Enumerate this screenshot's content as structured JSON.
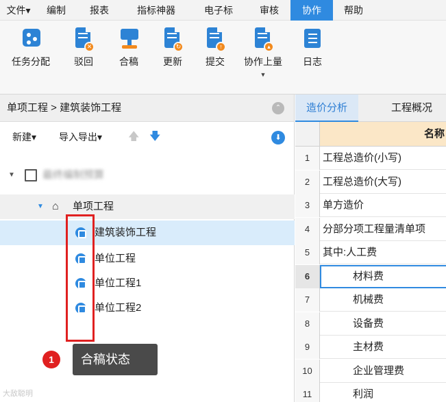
{
  "menu": {
    "items": [
      "文件▾",
      "编制",
      "报表",
      "指标神器",
      "电子标",
      "审核",
      "协作",
      "帮助"
    ],
    "active": "协作"
  },
  "ribbon": {
    "buttons": [
      {
        "label": "任务分配",
        "icon": "task-assign-icon"
      },
      {
        "label": "驳回",
        "icon": "reject-icon"
      },
      {
        "label": "合稿",
        "icon": "merge-icon"
      },
      {
        "label": "更新",
        "icon": "update-icon"
      },
      {
        "label": "提交",
        "icon": "submit-icon"
      },
      {
        "label": "协作上量",
        "icon": "collab-upload-icon"
      },
      {
        "label": "日志",
        "icon": "log-icon"
      }
    ],
    "dropdown_glyph": "▼"
  },
  "left": {
    "breadcrumb": "单项工程 > 建筑装饰工程",
    "toolbar": {
      "new_label": "新建▾",
      "import_export_label": "导入导出▾"
    },
    "tree": {
      "root_label": "最终编制预算",
      "group_label": "单项工程",
      "items": [
        "建筑装饰工程",
        "单位工程",
        "单位工程1",
        "单位工程2"
      ],
      "selected": "建筑装饰工程"
    },
    "callout": {
      "number": "1",
      "text": "合稿状态"
    },
    "watermark": "大敌聪明"
  },
  "right": {
    "tabs": [
      "造价分析",
      "工程概况"
    ],
    "active_tab": "造价分析",
    "table": {
      "header_name": "名称",
      "rows": [
        {
          "n": "1",
          "name": "工程总造价(小写)",
          "indent": false
        },
        {
          "n": "2",
          "name": "工程总造价(大写)",
          "indent": false
        },
        {
          "n": "3",
          "name": "单方造价",
          "indent": false
        },
        {
          "n": "4",
          "name": "分部分项工程量清单项",
          "indent": false
        },
        {
          "n": "5",
          "name": "其中:人工费",
          "indent": false
        },
        {
          "n": "6",
          "name": "材料费",
          "indent": true
        },
        {
          "n": "7",
          "name": "机械费",
          "indent": true
        },
        {
          "n": "8",
          "name": "设备费",
          "indent": true
        },
        {
          "n": "9",
          "name": "主材费",
          "indent": true
        },
        {
          "n": "10",
          "name": "企业管理费",
          "indent": true
        },
        {
          "n": "11",
          "name": "利润",
          "indent": true
        }
      ],
      "current_row": "6"
    }
  },
  "colors": {
    "accent": "#2f8ae0",
    "highlight": "#e02020",
    "header_bg": "#fbe7c7"
  }
}
